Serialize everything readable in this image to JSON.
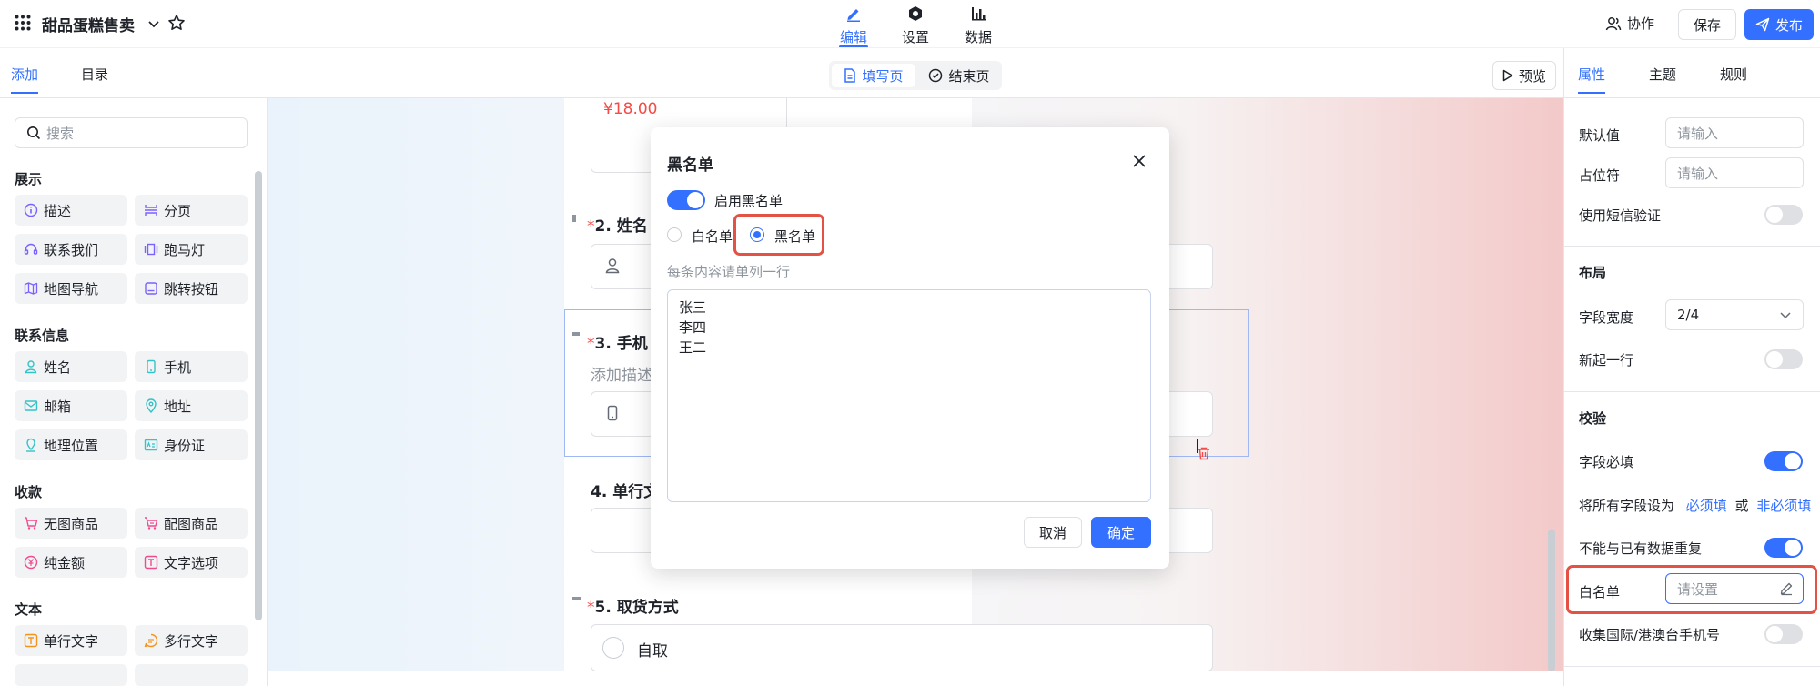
{
  "app": {
    "title": "甜品蛋糕售卖"
  },
  "top_tabs": [
    {
      "label": "编辑",
      "icon": "edit-icon",
      "active": true
    },
    {
      "label": "设置",
      "icon": "settings-icon",
      "active": false
    },
    {
      "label": "数据",
      "icon": "bar-chart-icon",
      "active": false
    }
  ],
  "top_actions": {
    "collab": "协作",
    "save": "保存",
    "publish": "发布"
  },
  "left_tabs": [
    {
      "label": "添加",
      "active": true
    },
    {
      "label": "目录",
      "active": false
    }
  ],
  "page_tabs": [
    {
      "label": "填写页",
      "active": true
    },
    {
      "label": "结束页",
      "active": false
    }
  ],
  "preview_label": "预览",
  "right_tabs": [
    {
      "label": "属性",
      "active": true
    },
    {
      "label": "主题",
      "active": false
    },
    {
      "label": "规则",
      "active": false
    }
  ],
  "search": {
    "placeholder": "搜索"
  },
  "groups": [
    {
      "title": "展示",
      "items": [
        {
          "label": "描述",
          "icon": "info-icon",
          "color": "#7b61ff"
        },
        {
          "label": "分页",
          "icon": "page-break-icon",
          "color": "#7b61ff"
        },
        {
          "label": "联系我们",
          "icon": "headset-icon",
          "color": "#7b61ff"
        },
        {
          "label": "跑马灯",
          "icon": "carousel-icon",
          "color": "#7b61ff"
        },
        {
          "label": "地图导航",
          "icon": "map-icon",
          "color": "#7b61ff"
        },
        {
          "label": "跳转按钮",
          "icon": "jump-button-icon",
          "color": "#7b61ff"
        }
      ]
    },
    {
      "title": "联系信息",
      "items": [
        {
          "label": "姓名",
          "icon": "person-icon",
          "color": "#34c3c7"
        },
        {
          "label": "手机",
          "icon": "phone-icon",
          "color": "#34c3c7"
        },
        {
          "label": "邮箱",
          "icon": "mail-icon",
          "color": "#34c3c7"
        },
        {
          "label": "地址",
          "icon": "location-icon",
          "color": "#34c3c7"
        },
        {
          "label": "地理位置",
          "icon": "geo-icon",
          "color": "#34c3c7"
        },
        {
          "label": "身份证",
          "icon": "id-card-icon",
          "color": "#34c3c7"
        }
      ]
    },
    {
      "title": "收款",
      "items": [
        {
          "label": "无图商品",
          "icon": "cart-icon",
          "color": "#f04b8f"
        },
        {
          "label": "配图商品",
          "icon": "cart-image-icon",
          "color": "#f04b8f"
        },
        {
          "label": "纯金额",
          "icon": "yen-icon",
          "color": "#f04b8f"
        },
        {
          "label": "文字选项",
          "icon": "text-option-icon",
          "color": "#f04b8f"
        }
      ]
    },
    {
      "title": "文本",
      "items": [
        {
          "label": "单行文字",
          "icon": "single-line-icon",
          "color": "#f5941d"
        },
        {
          "label": "多行文字",
          "icon": "multi-line-icon",
          "color": "#f5941d"
        }
      ]
    }
  ],
  "form": {
    "price": "¥18.00",
    "field2": {
      "req": "*",
      "label": "2. 姓名"
    },
    "field3": {
      "req": "*",
      "label": "3. 手机",
      "desc": "添加描述"
    },
    "field4": {
      "label": "4. 单行文"
    },
    "field5": {
      "req": "*",
      "label": "5. 取货方式",
      "option": "自取"
    }
  },
  "modal": {
    "title": "黑名单",
    "enable_label": "启用黑名单",
    "radio_white": "白名单",
    "radio_black": "黑名单",
    "hint": "每条内容请单列一行",
    "list": "张三\n李四\n王二",
    "cancel": "取消",
    "confirm": "确定"
  },
  "props": {
    "default_label": "默认值",
    "default_placeholder": "请输入",
    "placeholder_label": "占位符",
    "placeholder_placeholder": "请输入",
    "sms_label": "使用短信验证",
    "layout_title": "布局",
    "width_label": "字段宽度",
    "width_value": "2/4",
    "newline_label": "新起一行",
    "validate_title": "校验",
    "required_label": "字段必填",
    "all_fields_prefix": "将所有字段设为",
    "all_required": "必须填",
    "or": "或",
    "all_optional": "非必须填",
    "no_dup_label": "不能与已有数据重复",
    "whitelist_label": "白名单",
    "whitelist_placeholder": "请设置",
    "intl_label": "收集国际/港澳台手机号"
  },
  "colors": {
    "accent": "#3370ff",
    "danger": "#f54a45",
    "highlight": "#e35245"
  }
}
